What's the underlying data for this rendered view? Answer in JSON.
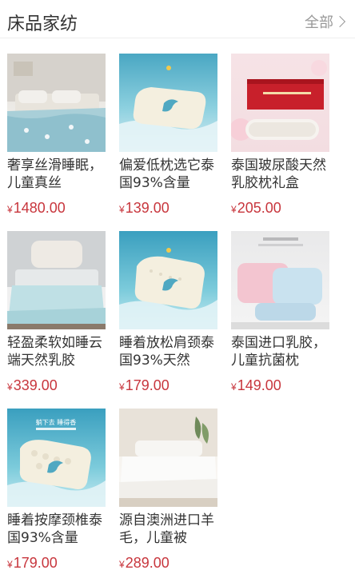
{
  "header": {
    "title": "床品家纺",
    "more_label": "全部"
  },
  "products": [
    {
      "name": "奢享丝滑睡眠，儿童真丝",
      "currency": "¥",
      "price": "1480.00",
      "image": "bed-set-blue"
    },
    {
      "name": "偏爱低枕选它泰国93%含量",
      "currency": "¥",
      "price": "139.00",
      "image": "latex-pillow-low"
    },
    {
      "name": "泰国玻尿酸天然乳胶枕礼盒",
      "currency": "¥",
      "price": "205.00",
      "image": "pillow-gift-box"
    },
    {
      "name": "轻盈柔软如睡云端天然乳胶",
      "currency": "¥",
      "price": "339.00",
      "image": "light-blanket"
    },
    {
      "name": "睡着放松肩颈泰国93%天然",
      "currency": "¥",
      "price": "179.00",
      "image": "latex-pillow-neck"
    },
    {
      "name": "泰国进口乳胶，儿童抗菌枕",
      "currency": "¥",
      "price": "149.00",
      "image": "kids-pillow"
    },
    {
      "name": "睡着按摩颈椎泰国93%含量",
      "currency": "¥",
      "price": "179.00",
      "image": "massage-pillow",
      "banner": "躺下去 睡得香"
    },
    {
      "name": "源自澳洲进口羊毛，儿童被",
      "currency": "¥",
      "price": "289.00",
      "image": "wool-duvet"
    }
  ],
  "colors": {
    "price": "#c8363d",
    "title": "#333333",
    "more": "#999999"
  }
}
